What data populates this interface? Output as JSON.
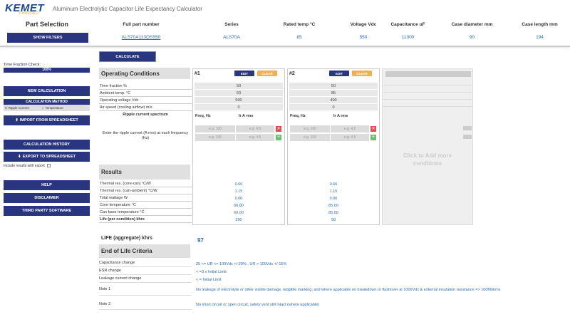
{
  "header": {
    "logo": "KEMET",
    "logo_sub": "CHARGED",
    "title": "Aluminum Electrolytic Capacitor Life Expectancy Calculator"
  },
  "part_selection": {
    "title": "Part Selection",
    "show_filters": "SHOW FILTERS",
    "columns": [
      {
        "label": "Full part number",
        "value": "ALS70A113QS550"
      },
      {
        "label": "Series",
        "value": "ALS70A"
      },
      {
        "label": "Rated temp °C",
        "value": "85"
      },
      {
        "label": "Voltage Vdc",
        "value": "550"
      },
      {
        "label": "Capacitance uF",
        "value": "11000"
      },
      {
        "label": "Case diameter mm",
        "value": "90"
      },
      {
        "label": "Case length mm",
        "value": "194"
      }
    ]
  },
  "sidebar": {
    "time_fraction_label": "Time Fraction Check:",
    "time_fraction_value": "100%",
    "time_fraction_level": 1.0,
    "new_calc": "NEW CALCULATION",
    "calc_method": "CALCULATION METHOD",
    "method_ripple": "Ripple Current",
    "method_temp": "Temperature",
    "import": "IMPORT FROM SPREADSHEET",
    "history": "CALCULATION HISTORY",
    "export": "EXPORT TO SPREADSHEET",
    "include_results": "Include results with export",
    "help": "HELP",
    "disclaimer": "DISCLAIMER",
    "third_party": "THIRD PARTY SOFTWARE"
  },
  "calculate": "CALCULATE",
  "operating": {
    "title": "Operating Conditions",
    "rows": [
      "Time fraction %",
      "Ambient temp. °C",
      "Operating voltage Vdc",
      "Air speed (cooling airflow) m/s"
    ],
    "ripple_title": "Ripple current spectrum",
    "ripple_desc": "Enter the ripple current (A rms) at each frequency (Hz)"
  },
  "conditions": [
    {
      "title": "#1",
      "edit": "EDIT",
      "clear": "CLEAR",
      "values": [
        "50",
        "60",
        "500",
        "0"
      ],
      "freq_label": "Freq, Hz",
      "irms_label": "Ir A rms",
      "freq_ph": "e.g. 100",
      "irms_ph": "e.g. 4.5",
      "results": [
        "0.66",
        "1.15",
        "0.00",
        "60.00",
        "60.00",
        "290"
      ]
    },
    {
      "title": "#2",
      "edit": "EDIT",
      "clear": "CLEAR",
      "values": [
        "50",
        "85",
        "400",
        "0"
      ],
      "freq_label": "Freq, Hz",
      "irms_label": "Ir A rms",
      "freq_ph": "e.g. 100",
      "irms_ph": "e.g. 4.5",
      "results": [
        "0.66",
        "1.15",
        "0.00",
        "85.00",
        "85.00",
        "58"
      ]
    }
  ],
  "add_conditions": "Click to Add more conditions",
  "results": {
    "title": "Results",
    "rows": [
      "Thermal res. (core-can) °C/W",
      "Thermal res. (can-ambient) °C/W",
      "Total wattage W",
      "Core temperature °C",
      "Can base temperature °C",
      "Life (per condition) khrs"
    ]
  },
  "life_aggregate": {
    "label": "LIFE (aggregate) khrs",
    "value": "97"
  },
  "end_of_life": {
    "title": "End of Life Criteria",
    "rows": [
      {
        "label": "Capacitance change",
        "value": "25 <= UR <= 100Vdc +/-20% , UR > 100Vdc +/-15%"
      },
      {
        "label": "ESR change",
        "value": "< =3 x Initial Limit"
      },
      {
        "label": "Leakage current change",
        "value": "< = Initial Limit"
      },
      {
        "label": "Note 1",
        "value": "No leakage of electrolyte or other visible damage, ledgible marking, and where applicable no breakdown or flashover at 1000Vdc & external insulation resistance => 100Mohms"
      },
      {
        "label": "Note 2",
        "value": "No short circuit or open circuit, safety vent still intact (where applicable)"
      }
    ]
  }
}
